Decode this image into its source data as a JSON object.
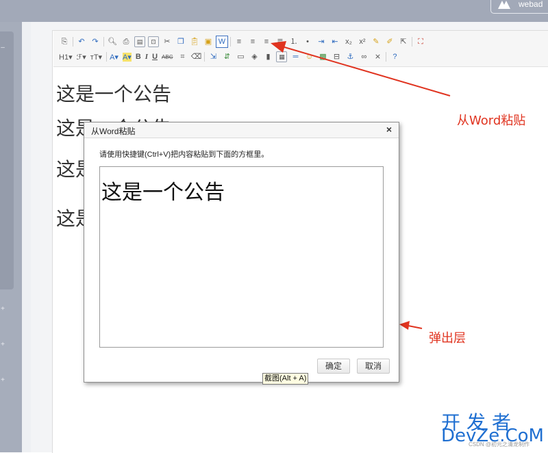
{
  "header": {
    "user_label": "webad"
  },
  "toolbar": {
    "heading_label": "H1",
    "font_family_label": "ℱ",
    "font_size_label": "тT",
    "font_color_label": "A",
    "highlight_label": "A",
    "bold_label": "B",
    "italic_label": "I",
    "underline_label": "U",
    "strike_label": "ABC"
  },
  "document": {
    "lines": [
      "这是一个公告",
      "这是一个公告",
      "这是",
      "这是"
    ]
  },
  "annotations": {
    "word_paste_label": "从Word粘贴",
    "popup_label": "弹出层"
  },
  "dialog": {
    "title": "从Word粘贴",
    "close_glyph": "×",
    "instruction": "请使用快捷键(Ctrl+V)把内容粘贴到下面的方框里。",
    "pasted_content": "这是一个公告",
    "ok_label": "确定",
    "cancel_label": "取消"
  },
  "tooltip": {
    "text": "截图(Alt + A)"
  },
  "watermark": {
    "cn": "开发者",
    "en": "DevZe.CoM",
    "small": "CSDN @初元之清龙制作"
  },
  "sidebar": {
    "expand_glyph": "+"
  },
  "colors": {
    "annotation_red": "#e0331f",
    "watermark_blue": "#1f6fd1",
    "topbar": "#a2a9b8"
  }
}
